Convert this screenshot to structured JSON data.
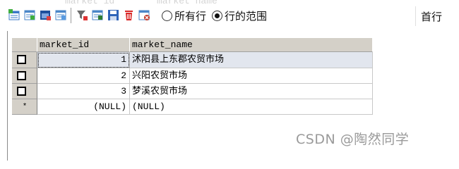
{
  "toolbar": {
    "ghost_header_1": "market_id",
    "ghost_header_2": "market_name",
    "buttons": [
      {
        "name": "add-row-icon",
        "color": "#3b78c7"
      },
      {
        "name": "save-grid-icon",
        "color": "#4a86c8"
      },
      {
        "name": "duplicate-row-icon",
        "color": "#1d4f9c"
      },
      {
        "name": "copy-row-icon",
        "color": "#4a86c8"
      },
      {
        "name": "filter-icon",
        "color": "#6b6b6b"
      },
      {
        "name": "refresh-icon",
        "color": "#4a86c8"
      },
      {
        "name": "save-icon",
        "color": "#2f64b8"
      },
      {
        "name": "delete-icon",
        "color": "#d92626"
      },
      {
        "name": "cancel-changes-icon",
        "color": "#c0392b"
      }
    ],
    "radio_all_rows": "所有行",
    "radio_row_range": "行的范围",
    "selected_radio": "行的范围",
    "first_row_label": "首行"
  },
  "grid": {
    "columns": [
      "market_id",
      "market_name"
    ],
    "rows": [
      {
        "market_id": "1",
        "market_name": "沭阳县上东郡农贸市场",
        "selected": true
      },
      {
        "market_id": "2",
        "market_name": "兴阳农贸市场",
        "selected": false
      },
      {
        "market_id": "3",
        "market_name": "梦溪农贸市场",
        "selected": false
      }
    ],
    "new_row": {
      "marker": "*",
      "market_id": "(NULL)",
      "market_name": "(NULL)"
    }
  },
  "watermark": "CSDN @陶然同学",
  "colors": {
    "header_bg": "#d4d0c8",
    "selected_row_bg": "#e2e6ee",
    "grid_line": "#c8c8c8"
  }
}
